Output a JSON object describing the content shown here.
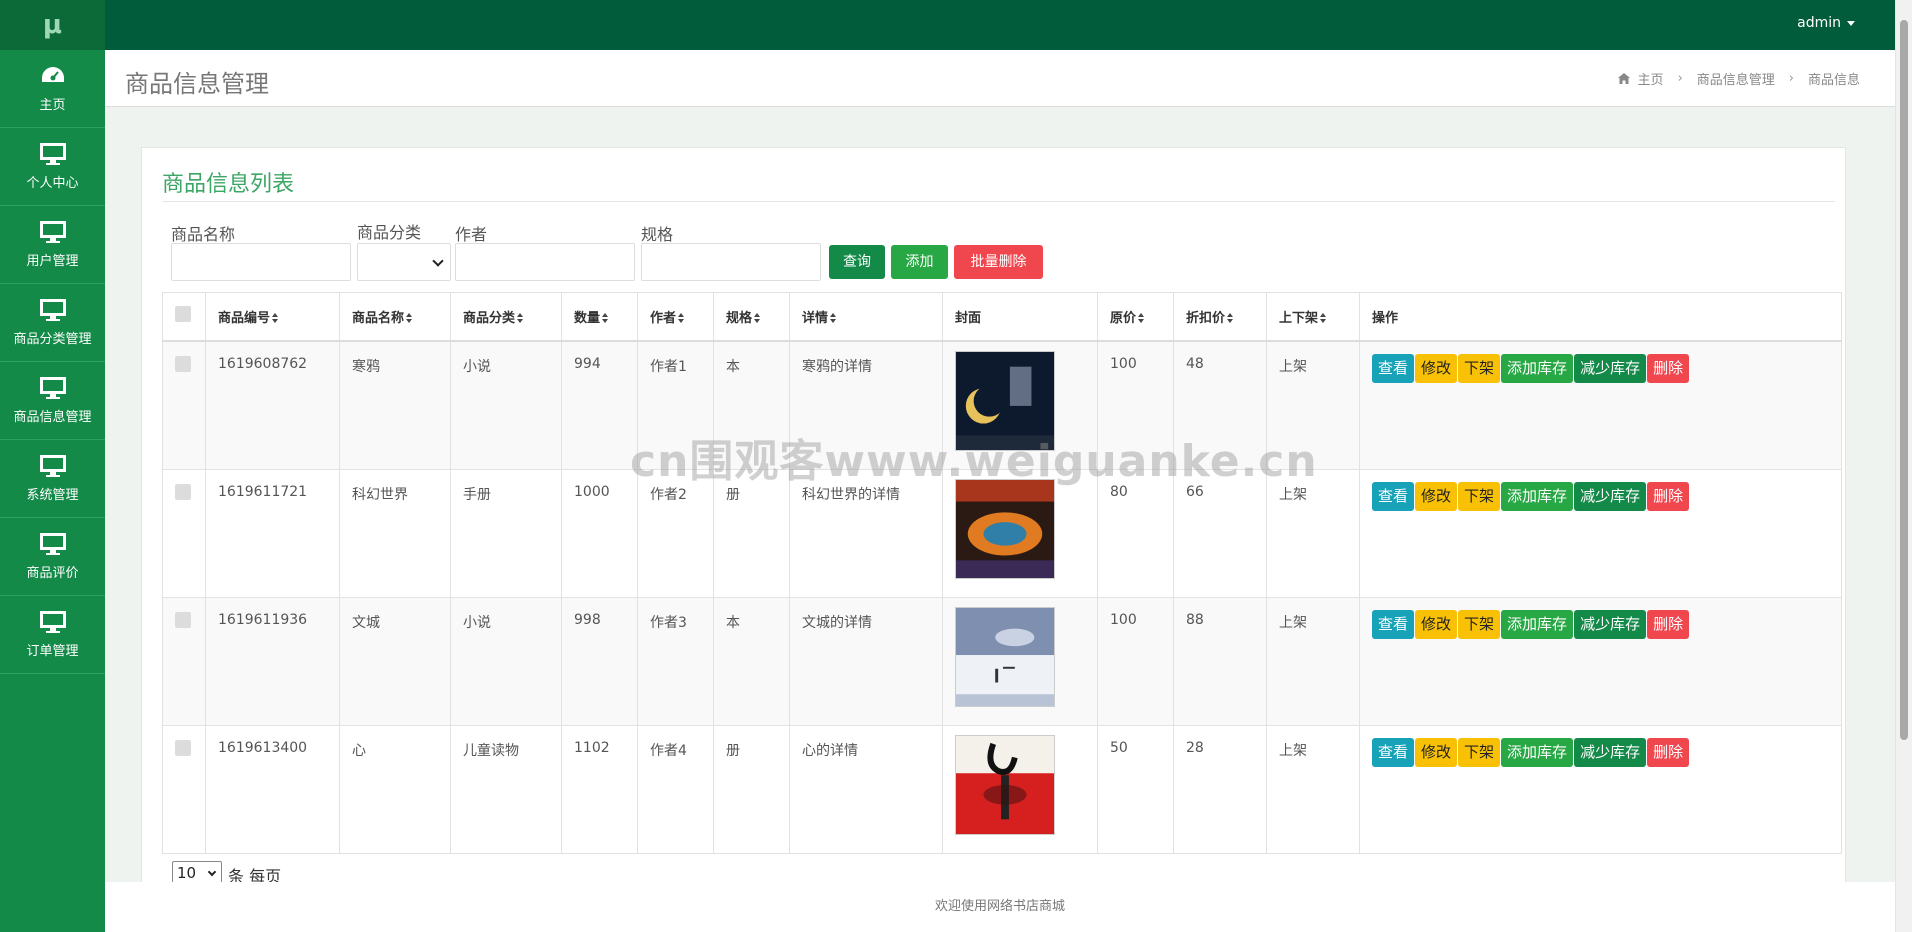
{
  "sidebar": {
    "logo": "μ",
    "items": [
      {
        "label": "主页",
        "icon": "dashboard-icon"
      },
      {
        "label": "个人中心",
        "icon": "monitor-icon"
      },
      {
        "label": "用户管理",
        "icon": "monitor-icon"
      },
      {
        "label": "商品分类管理",
        "icon": "monitor-icon"
      },
      {
        "label": "商品信息管理",
        "icon": "monitor-icon"
      },
      {
        "label": "系统管理",
        "icon": "monitor-icon"
      },
      {
        "label": "商品评价",
        "icon": "monitor-icon"
      },
      {
        "label": "订单管理",
        "icon": "monitor-icon"
      }
    ]
  },
  "topbar": {
    "user": "admin"
  },
  "header": {
    "title": "商品信息管理",
    "breadcrumb": [
      "主页",
      "商品信息管理",
      "商品信息"
    ]
  },
  "panel": {
    "title": "商品信息列表"
  },
  "filters": {
    "name_label": "商品名称",
    "category_label": "商品分类",
    "author_label": "作者",
    "spec_label": "规格",
    "name_value": "",
    "author_value": "",
    "spec_value": "",
    "category_value": ""
  },
  "buttons": {
    "search": "查询",
    "add": "添加",
    "batch_delete": "批量删除"
  },
  "table": {
    "headers": [
      "商品编号",
      "商品名称",
      "商品分类",
      "数量",
      "作者",
      "规格",
      "详情",
      "封面",
      "原价",
      "折扣价",
      "上下架",
      "操作"
    ],
    "rows": [
      {
        "id": "1619608762",
        "name": "寒鸦",
        "category": "小说",
        "qty": "994",
        "author": "作者1",
        "spec": "本",
        "detail": "寒鸦的详情",
        "price": "100",
        "discount": "48",
        "status": "上架"
      },
      {
        "id": "1619611721",
        "name": "科幻世界",
        "category": "手册",
        "qty": "1000",
        "author": "作者2",
        "spec": "册",
        "detail": "科幻世界的详情",
        "price": "80",
        "discount": "66",
        "status": "上架"
      },
      {
        "id": "1619611936",
        "name": "文城",
        "category": "小说",
        "qty": "998",
        "author": "作者3",
        "spec": "本",
        "detail": "文城的详情",
        "price": "100",
        "discount": "88",
        "status": "上架"
      },
      {
        "id": "1619613400",
        "name": "心",
        "category": "儿童读物",
        "qty": "1102",
        "author": "作者4",
        "spec": "册",
        "detail": "心的详情",
        "price": "50",
        "discount": "28",
        "status": "上架"
      }
    ],
    "row_actions": [
      "查看",
      "修改",
      "下架",
      "添加库存",
      "减少库存",
      "删除"
    ]
  },
  "pagination": {
    "page_size": "10",
    "per_page_label": "条 每页"
  },
  "footer": {
    "text": "欢迎使用网络书店商城"
  },
  "watermark": "cn围观客www.weiguanke.cn",
  "colors": {
    "sidebar": "#138a48",
    "topbar": "#005c3a",
    "accent": "#3ca665",
    "btn_search": "#138a48",
    "btn_add": "#28a745",
    "btn_delete": "#f0474e",
    "op_view": "#17a2b8",
    "op_edit": "#f9c106",
    "op_down": "#f9c106",
    "op_add": "#28a745",
    "op_reduce": "#138a48",
    "op_delete": "#f0474e"
  }
}
